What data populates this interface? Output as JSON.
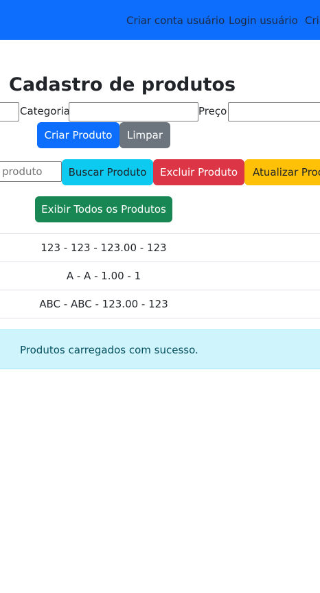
{
  "navbar": {
    "links": [
      "Criar conta usuário",
      "Login usuário",
      "Cria"
    ],
    "bg_color": "#0d6efd"
  },
  "page": {
    "title": "Cadastro de produtos"
  },
  "form": {
    "category_label": "Categoria:",
    "price_label": "Preço:",
    "create_button": "Criar Produto",
    "clear_button": "Limpar"
  },
  "search": {
    "placeholder": "o produto",
    "search_button": "Buscar Produto",
    "delete_button": "Excluir Produto",
    "update_button": "Atualizar Prod"
  },
  "list": {
    "show_all_button": "Exibir Todos os Produtos",
    "items": [
      "123 - 123 - 123.00 - 123",
      "A - A - 1.00 - 1",
      "ABC - ABC - 123.00 - 123"
    ]
  },
  "alert": {
    "message": "Produtos carregados com sucesso.",
    "bg_color": "#cff4fc"
  }
}
